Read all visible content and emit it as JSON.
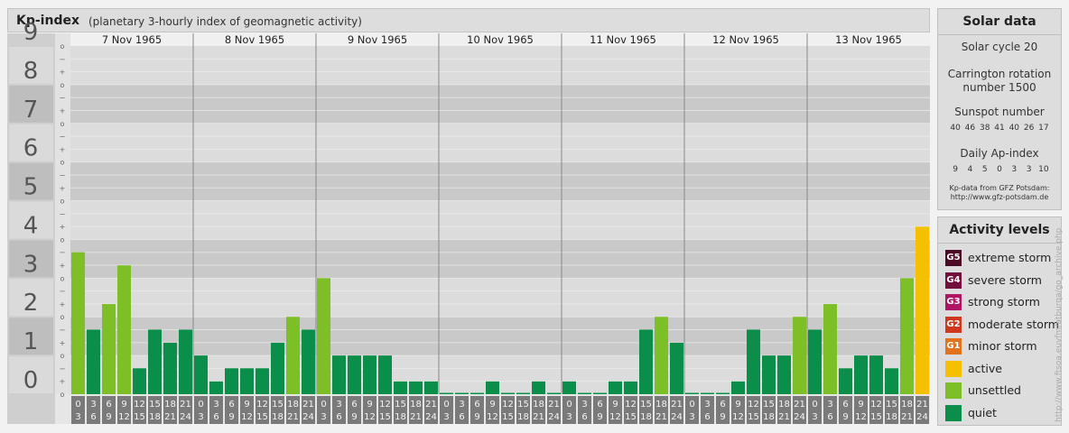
{
  "header": {
    "title": "Kp-index",
    "subtitle": "(planetary 3-hourly index of geomagnetic activity)"
  },
  "solar": {
    "title": "Solar data",
    "cycle": "Solar cycle 20",
    "carrington_line1": "Carrington rotation",
    "carrington_line2": "number 1500",
    "sunspot_label": "Sunspot number",
    "sunspot_values": [
      "40",
      "46",
      "38",
      "41",
      "40",
      "26",
      "17"
    ],
    "ap_label": "Daily Ap-index",
    "ap_values": [
      "9",
      "4",
      "5",
      "0",
      "3",
      "3",
      "10"
    ],
    "credit_line1": "Kp-data from GFZ Potsdam:",
    "credit_line2": "http://www.gfz-potsdam.de"
  },
  "levels": {
    "title": "Activity levels",
    "items": [
      {
        "badge": "G5",
        "label": "extreme storm",
        "color": "#4b0a26"
      },
      {
        "badge": "G4",
        "label": "severe storm",
        "color": "#730f3c"
      },
      {
        "badge": "G3",
        "label": "strong storm",
        "color": "#b01565"
      },
      {
        "badge": "G2",
        "label": "moderate storm",
        "color": "#d0381e"
      },
      {
        "badge": "G1",
        "label": "minor storm",
        "color": "#e2721c"
      },
      {
        "badge": "",
        "label": "active",
        "color": "#f5c000"
      },
      {
        "badge": "",
        "label": "unsettled",
        "color": "#7cbf27"
      },
      {
        "badge": "",
        "label": "quiet",
        "color": "#0b8e49"
      }
    ]
  },
  "watermark": "http://www.ftsoa.euvfm/atburqa/go_archive.php",
  "colors": {
    "quiet": "#0b8e49",
    "unsettled": "#7cbf27",
    "active": "#f5c000"
  },
  "chart_data": {
    "type": "bar",
    "ylim": [
      0,
      9
    ],
    "y_major_ticks": [
      "0",
      "1",
      "2",
      "3",
      "4",
      "5",
      "6",
      "7",
      "8",
      "9"
    ],
    "y_minor_ticks": [
      "o",
      "+",
      "−"
    ],
    "days": [
      "7 Nov 1965",
      "8 Nov 1965",
      "9 Nov 1965",
      "10 Nov 1965",
      "11 Nov 1965",
      "12 Nov 1965",
      "13 Nov 1965"
    ],
    "hour_ticks": [
      [
        "0",
        "3"
      ],
      [
        "3",
        "6"
      ],
      [
        "6",
        "9"
      ],
      [
        "9",
        "12"
      ],
      [
        "12",
        "15"
      ],
      [
        "15",
        "18"
      ],
      [
        "18",
        "21"
      ],
      [
        "21",
        "24"
      ]
    ],
    "values": [
      [
        3.67,
        1.67,
        2.33,
        3.33,
        0.67,
        1.67,
        1.33,
        1.67
      ],
      [
        1.0,
        0.33,
        0.67,
        0.67,
        0.67,
        1.33,
        2.0,
        1.67
      ],
      [
        3.0,
        1.0,
        1.0,
        1.0,
        1.0,
        0.33,
        0.33,
        0.33
      ],
      [
        0.0,
        0.0,
        0.0,
        0.33,
        0.0,
        0.0,
        0.33,
        0.0
      ],
      [
        0.33,
        0.0,
        0.0,
        0.33,
        0.33,
        1.67,
        2.0,
        1.33
      ],
      [
        0.0,
        0.0,
        0.0,
        0.33,
        1.67,
        1.0,
        1.0,
        2.0
      ],
      [
        1.67,
        2.33,
        0.67,
        1.0,
        1.0,
        0.67,
        3.0,
        4.33
      ]
    ],
    "grid": true
  }
}
